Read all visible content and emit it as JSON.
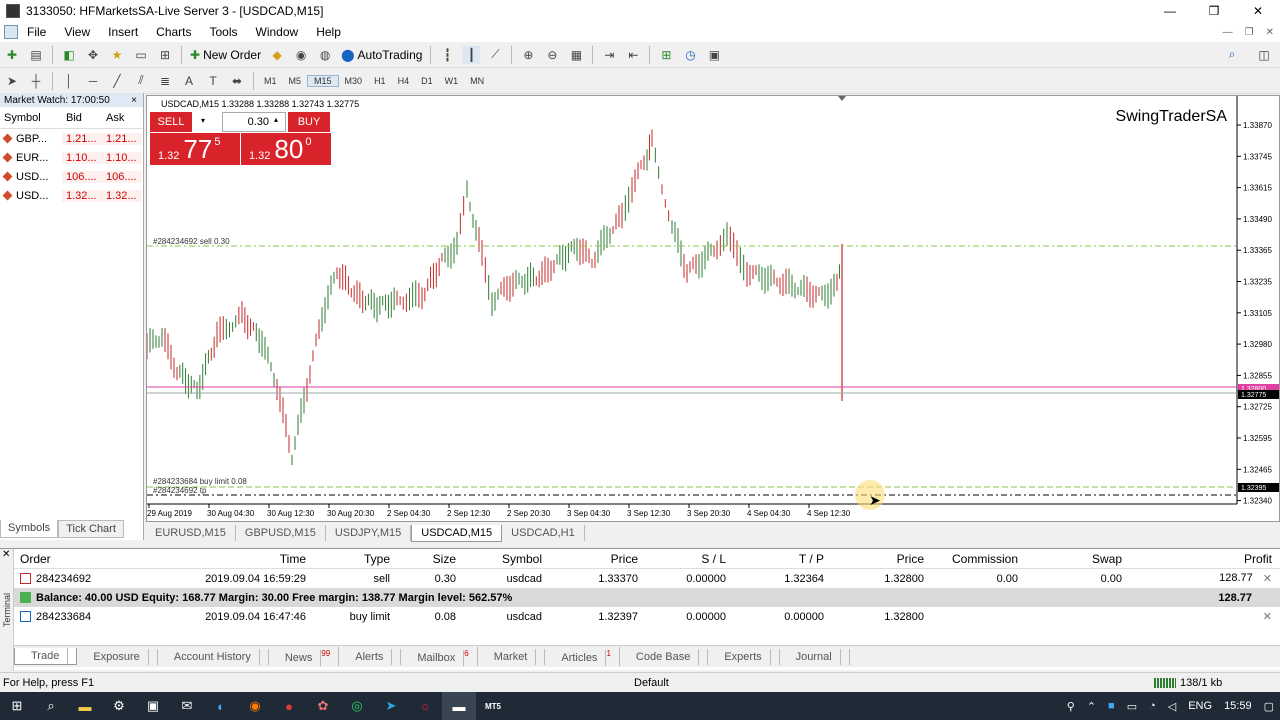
{
  "window": {
    "title": "3133050: HFMarketsSA-Live Server 3 - [USDCAD,M15]"
  },
  "menu": [
    "File",
    "View",
    "Insert",
    "Charts",
    "Tools",
    "Window",
    "Help"
  ],
  "toolbar": {
    "new_order": "New Order",
    "autotrading": "AutoTrading"
  },
  "timeframes": [
    "M1",
    "M5",
    "M15",
    "M30",
    "H1",
    "H4",
    "D1",
    "W1",
    "MN"
  ],
  "active_timeframe": "M15",
  "market_watch": {
    "title": "Market Watch: 17:00:50",
    "close": "×",
    "headers": [
      "Symbol",
      "Bid",
      "Ask"
    ],
    "rows": [
      {
        "symbol": "GBP...",
        "bid": "1.21...",
        "ask": "1.21..."
      },
      {
        "symbol": "EUR...",
        "bid": "1.10...",
        "ask": "1.10..."
      },
      {
        "symbol": "USD...",
        "bid": "106....",
        "ask": "106...."
      },
      {
        "symbol": "USD...",
        "bid": "1.32...",
        "ask": "1.32..."
      }
    ],
    "tabs": [
      "Symbols",
      "Tick Chart"
    ]
  },
  "chart": {
    "header": "USDCAD,M15  1.33288 1.33288 1.32743 1.32775",
    "watermark": "SwingTraderSA",
    "sell_label": "SELL",
    "buy_label": "BUY",
    "lot": "0.30",
    "sell_price": {
      "prefix": "1.32",
      "big": "77",
      "sup": "5"
    },
    "buy_price": {
      "prefix": "1.32",
      "big": "80",
      "sup": "0"
    },
    "order_line_1": "#284234692 sell 0.30",
    "order_line_2": "#284233684 buy limit 0.08",
    "order_line_3": "#284234692 tp",
    "price_axis": [
      "1.33870",
      "1.33745",
      "1.33615",
      "1.33490",
      "1.33365",
      "1.33235",
      "1.33105",
      "1.32980",
      "1.32855",
      "1.32725",
      "1.32595",
      "1.32465",
      "1.32340"
    ],
    "price_tags": {
      "current": "1.32775",
      "sell": "1.32800",
      "limit": "1.32395"
    },
    "time_axis": [
      "29 Aug 2019",
      "30 Aug 04:30",
      "30 Aug 12:30",
      "30 Aug 20:30",
      "2 Sep 04:30",
      "2 Sep 12:30",
      "2 Sep 20:30",
      "3 Sep 04:30",
      "3 Sep 12:30",
      "3 Sep 20:30",
      "4 Sep 04:30",
      "4 Sep 12:30"
    ],
    "colors": {
      "bull": "#2e7d32",
      "bear": "#c62828",
      "sell_line": "#8bc34a",
      "price_line": "#e040a0",
      "tp_line": "#000000"
    }
  },
  "chart_tabs": [
    "EURUSD,M15",
    "GBPUSD,M15",
    "USDJPY,M15",
    "USDCAD,M15",
    "USDCAD,H1"
  ],
  "active_chart_tab": "USDCAD,M15",
  "terminal": {
    "side_label": "Terminal",
    "headers": [
      "Order",
      "Time",
      "Type",
      "Size",
      "Symbol",
      "Price",
      "S / L",
      "T / P",
      "Price",
      "Commission",
      "Swap",
      "Profit"
    ],
    "rows": [
      {
        "order": "284234692",
        "time": "2019.09.04 16:59:29",
        "type": "sell",
        "size": "0.30",
        "symbol": "usdcad",
        "price": "1.33370",
        "sl": "0.00000",
        "tp": "1.32364",
        "cur_price": "1.32800",
        "commission": "0.00",
        "swap": "0.00",
        "profit": "128.77"
      },
      {
        "order": "284233684",
        "time": "2019.09.04 16:47:46",
        "type": "buy limit",
        "size": "0.08",
        "symbol": "usdcad",
        "price": "1.32397",
        "sl": "0.00000",
        "tp": "0.00000",
        "cur_price": "1.32800",
        "commission": "",
        "swap": "",
        "profit": ""
      }
    ],
    "balance_line": "Balance: 40.00 USD  Equity: 168.77  Margin: 30.00  Free margin: 138.77  Margin level: 562.57%",
    "balance_profit": "128.77",
    "tabs": [
      {
        "label": "Trade",
        "badge": ""
      },
      {
        "label": "Exposure",
        "badge": ""
      },
      {
        "label": "Account History",
        "badge": ""
      },
      {
        "label": "News",
        "badge": "99"
      },
      {
        "label": "Alerts",
        "badge": ""
      },
      {
        "label": "Mailbox",
        "badge": "6"
      },
      {
        "label": "Market",
        "badge": ""
      },
      {
        "label": "Articles",
        "badge": "1"
      },
      {
        "label": "Code Base",
        "badge": ""
      },
      {
        "label": "Experts",
        "badge": ""
      },
      {
        "label": "Journal",
        "badge": ""
      }
    ]
  },
  "status": {
    "help": "For Help, press F1",
    "profile": "Default",
    "traffic": "138/1 kb"
  },
  "taskbar": {
    "lang": "ENG",
    "time": "15:59",
    "mt5": "MT5"
  }
}
